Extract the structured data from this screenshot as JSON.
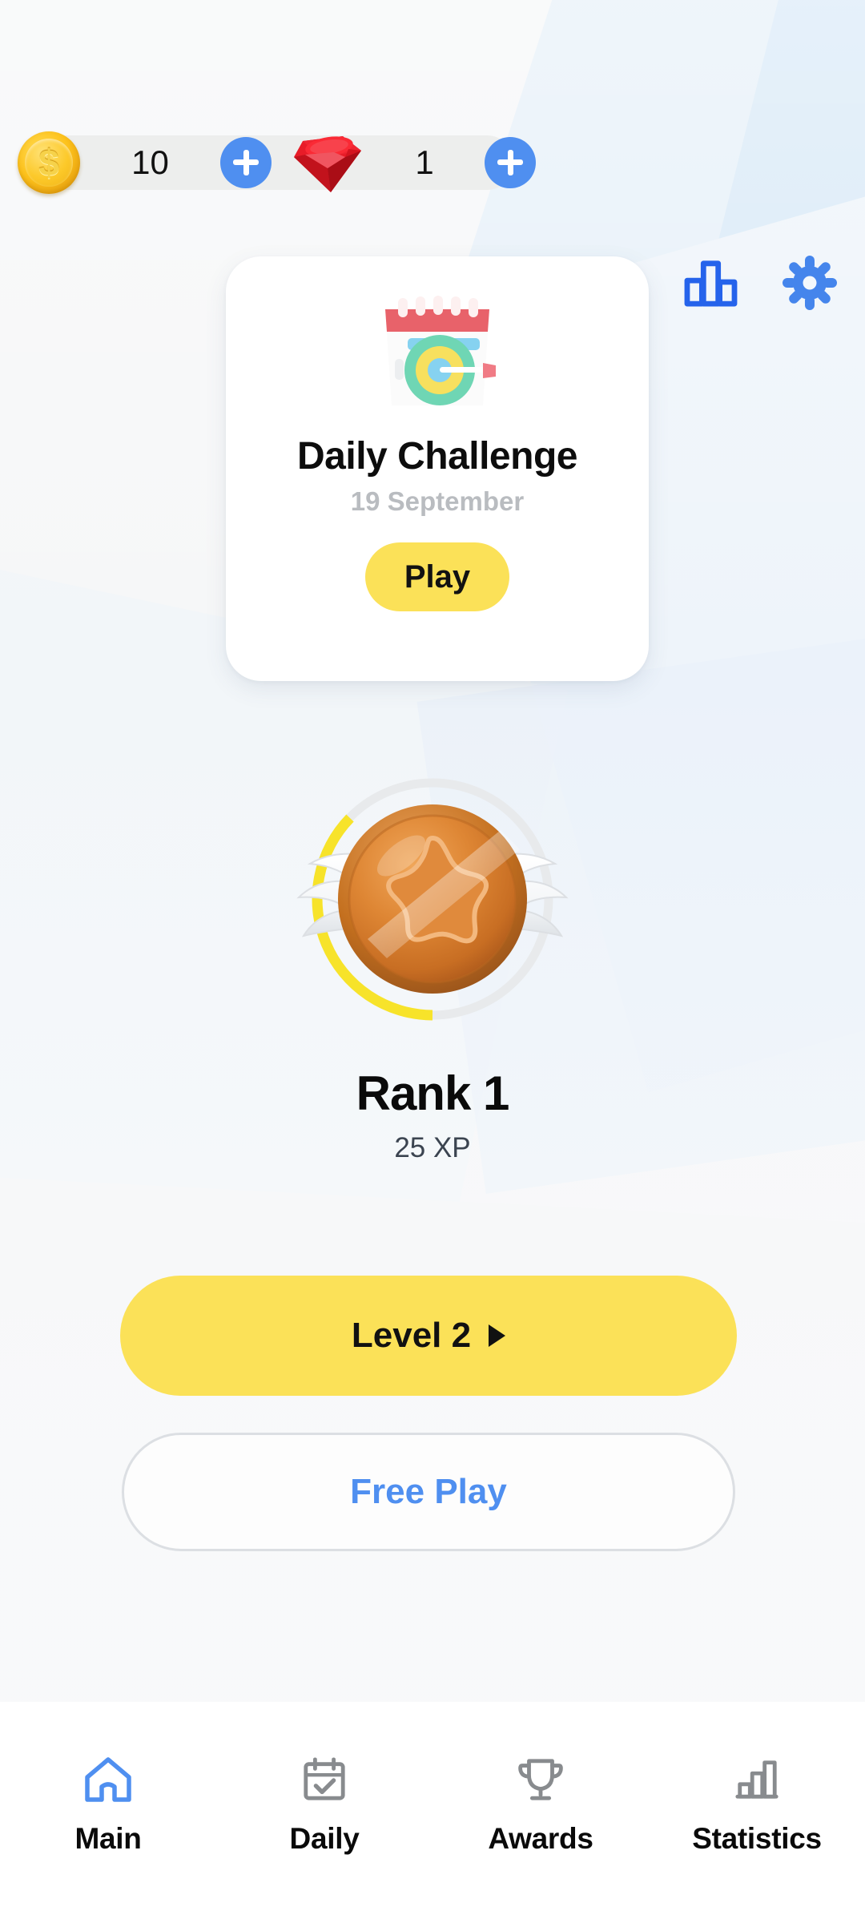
{
  "theme": {
    "accent_blue": "#4f8ff0",
    "icon_blue": "#2563eb",
    "accent_yellow": "#fbe158",
    "progress_yellow": "#f7e32a",
    "track_gray": "#e8eaec",
    "bronze": "#d97f2b",
    "text_dark": "#0a0a0a",
    "text_muted": "#b9bcc0",
    "nav_inactive": "#888b8e"
  },
  "topbar": {
    "coin": {
      "icon": "gold-coin-icon",
      "symbol": "$",
      "value": "10",
      "add_label": "+"
    },
    "gem": {
      "icon": "ruby-gem-icon",
      "value": "1",
      "add_label": "+"
    },
    "icons": [
      {
        "name": "award-ribbon-icon"
      },
      {
        "name": "bar-chart-icon"
      },
      {
        "name": "settings-gear-icon"
      }
    ]
  },
  "daily_challenge": {
    "icon": "calendar-target-icon",
    "title": "Daily Challenge",
    "date": "19 September",
    "play_label": "Play"
  },
  "rank": {
    "badge_icon": "winged-star-medal-icon",
    "title": "Rank 1",
    "xp": "25 XP",
    "progress_percent": 25
  },
  "actions": {
    "level_label": "Level 2",
    "level_caret": "play-caret-icon",
    "free_play_label": "Free Play"
  },
  "bottom_nav": {
    "items": [
      {
        "label": "Main",
        "icon": "home-icon",
        "active": true
      },
      {
        "label": "Daily",
        "icon": "calendar-check-icon",
        "active": false
      },
      {
        "label": "Awards",
        "icon": "trophy-icon",
        "active": false
      },
      {
        "label": "Statistics",
        "icon": "bar-chart-icon",
        "active": false
      }
    ]
  }
}
